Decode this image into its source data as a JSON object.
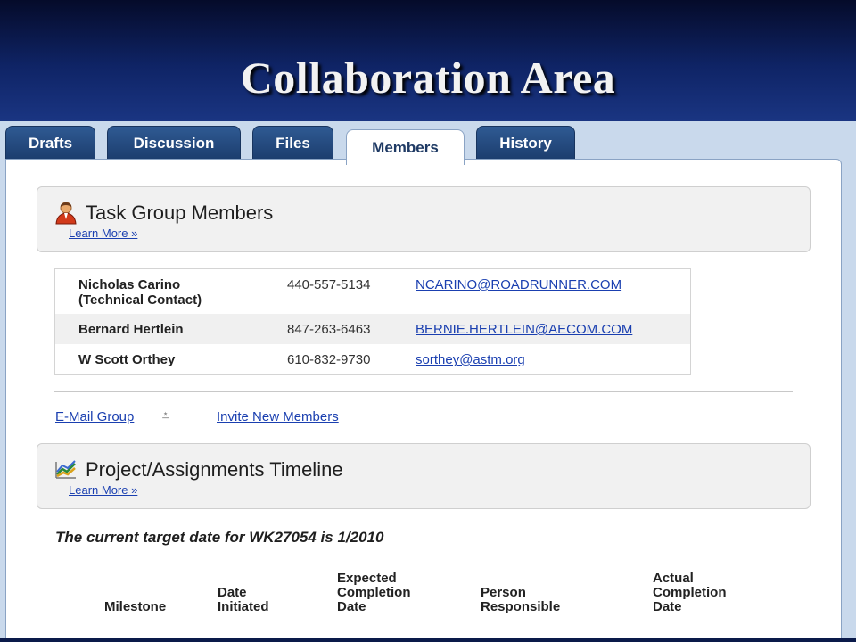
{
  "slide": {
    "title": "Collaboration Area"
  },
  "tabs": [
    {
      "label": "Drafts"
    },
    {
      "label": "Discussion"
    },
    {
      "label": "Files"
    },
    {
      "label": "Members",
      "active": true
    },
    {
      "label": "History"
    }
  ],
  "members_section": {
    "title": "Task Group Members",
    "learn_more": "Learn More »",
    "icon": "person-icon",
    "members": [
      {
        "name_line1": "Nicholas Carino",
        "name_line2": "(Technical Contact)",
        "phone": "440-557-5134",
        "email": "NCARINO@ROADRUNNER.COM"
      },
      {
        "name_line1": "Bernard Hertlein",
        "phone": "847-263-6463",
        "email": "BERNIE.HERTLEIN@AECOM.COM"
      },
      {
        "name_line1": "W Scott Orthey",
        "phone": "610-832-9730",
        "email": "sorthey@astm.org"
      }
    ]
  },
  "actions": {
    "email_group": "E-Mail Group",
    "invite": "Invite New Members"
  },
  "timeline_section": {
    "title": "Project/Assignments Timeline",
    "learn_more": "Learn More »",
    "icon": "chart-icon",
    "target_text": "The current target date for WK27054 is 1/2010",
    "columns": [
      {
        "line1": "Milestone"
      },
      {
        "line1": "Date",
        "line2": "Initiated"
      },
      {
        "line1": "Expected",
        "line2": "Completion",
        "line3": "Date"
      },
      {
        "line1": "Person",
        "line2": "Responsible"
      },
      {
        "line1": "Actual",
        "line2": "Completion",
        "line3": "Date"
      }
    ]
  },
  "colors": {
    "tab_blue": "#23487f",
    "link_blue": "#1a3fb0",
    "slide_bg": "#0a1a4a"
  }
}
